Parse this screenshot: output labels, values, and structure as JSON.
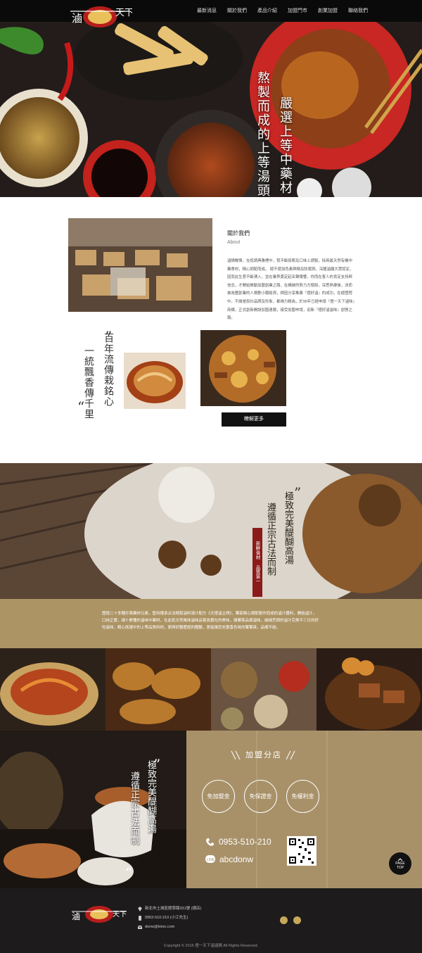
{
  "brand": {
    "logo_text": "滷一天下"
  },
  "nav": {
    "items": [
      "最新消息",
      "關於我們",
      "產品介紹",
      "加盟門市",
      "創業加盟",
      "聯絡我們"
    ]
  },
  "hero": {
    "lines": [
      "熬製而成的上等湯頭",
      "嚴選上等中藥材"
    ]
  },
  "about": {
    "heading": "關於我們",
    "subheading": "About",
    "body": "滷鍋暢情，在低調典雅裡中，我不斷探索及口味上調製，採用最天然有機中藥食材，精心調配而成。 經不使加色素與精及防腐劑，深獲滷癮大眾認定，因而此生意不斷湧入，並在業界奠定起名聲傳響，你而在客人的肯定支持與信念，才開始推動加盟創業之路，在構被的努力方頭設，深思熟慮後，決而被為豐創業的人規劃小額投資，師因分享推廣『燈好滷』的成功，在經歷程中，不論是設計品牌及形象，都竭力精為，於95年已經申請『燈一天下滷味』商標，正式創新開設加盟連鎖，接受加盟申請，迎新『燈好滷滷味』創營之路。",
    "poem": [
      "百年流傳栽銘心",
      "一統飄香傳千里"
    ],
    "more_button": "瞭解更多"
  },
  "story": {
    "poem": [
      "極致完美醍醐高湯",
      "遵循正宗古法而制"
    ],
    "badge": "新鮮食材 品質第一",
    "band_text": "歷經二十多種珍貴藥材元素，堅持傳承古法精製滷料湯汁配方《天燈滷立碑》，獨家精心調配製作而成的滷汁醬料，開始滷汁，口純正實，細十數種的滷味中藥材，在此乾天然風味滷味品嘗為實在的美味，讓饕客品嚐滷味，細細烹調的滷汁完美平三日的好吃滋味，精心既選中的上等品質料材，更與好聽歷經的體驗，更能讓您充實香色味的饕饕爽，品嚐不絕。"
  },
  "franchise": {
    "poem": [
      "極致完美醍醐高湯",
      "遵循正宗古法而制"
    ],
    "title": "加盟分店",
    "perks": [
      "免加盟金",
      "免保證金",
      "免權利金"
    ],
    "phone": "0953-510-210",
    "line_id": "abcdonw"
  },
  "page_top": {
    "label": "PAGE TOP"
  },
  "footer": {
    "address": "新北市土城區館學路331號 (總店)",
    "phone": "0953-510-210 (小江先生)",
    "email": "donw@kimo.com",
    "copyright": "Copyright © 2016 燈一天下滷滷鍋 All Rights Reserved."
  },
  "colors": {
    "gold": "#a89169",
    "dark": "#1d1b1b",
    "accent_red": "#8b1b1b"
  },
  "icons": [
    "chili-icon",
    "phone-icon",
    "line-icon",
    "location-icon",
    "mail-icon",
    "facebook-icon",
    "instagram-icon",
    "chevron-up-icon"
  ]
}
